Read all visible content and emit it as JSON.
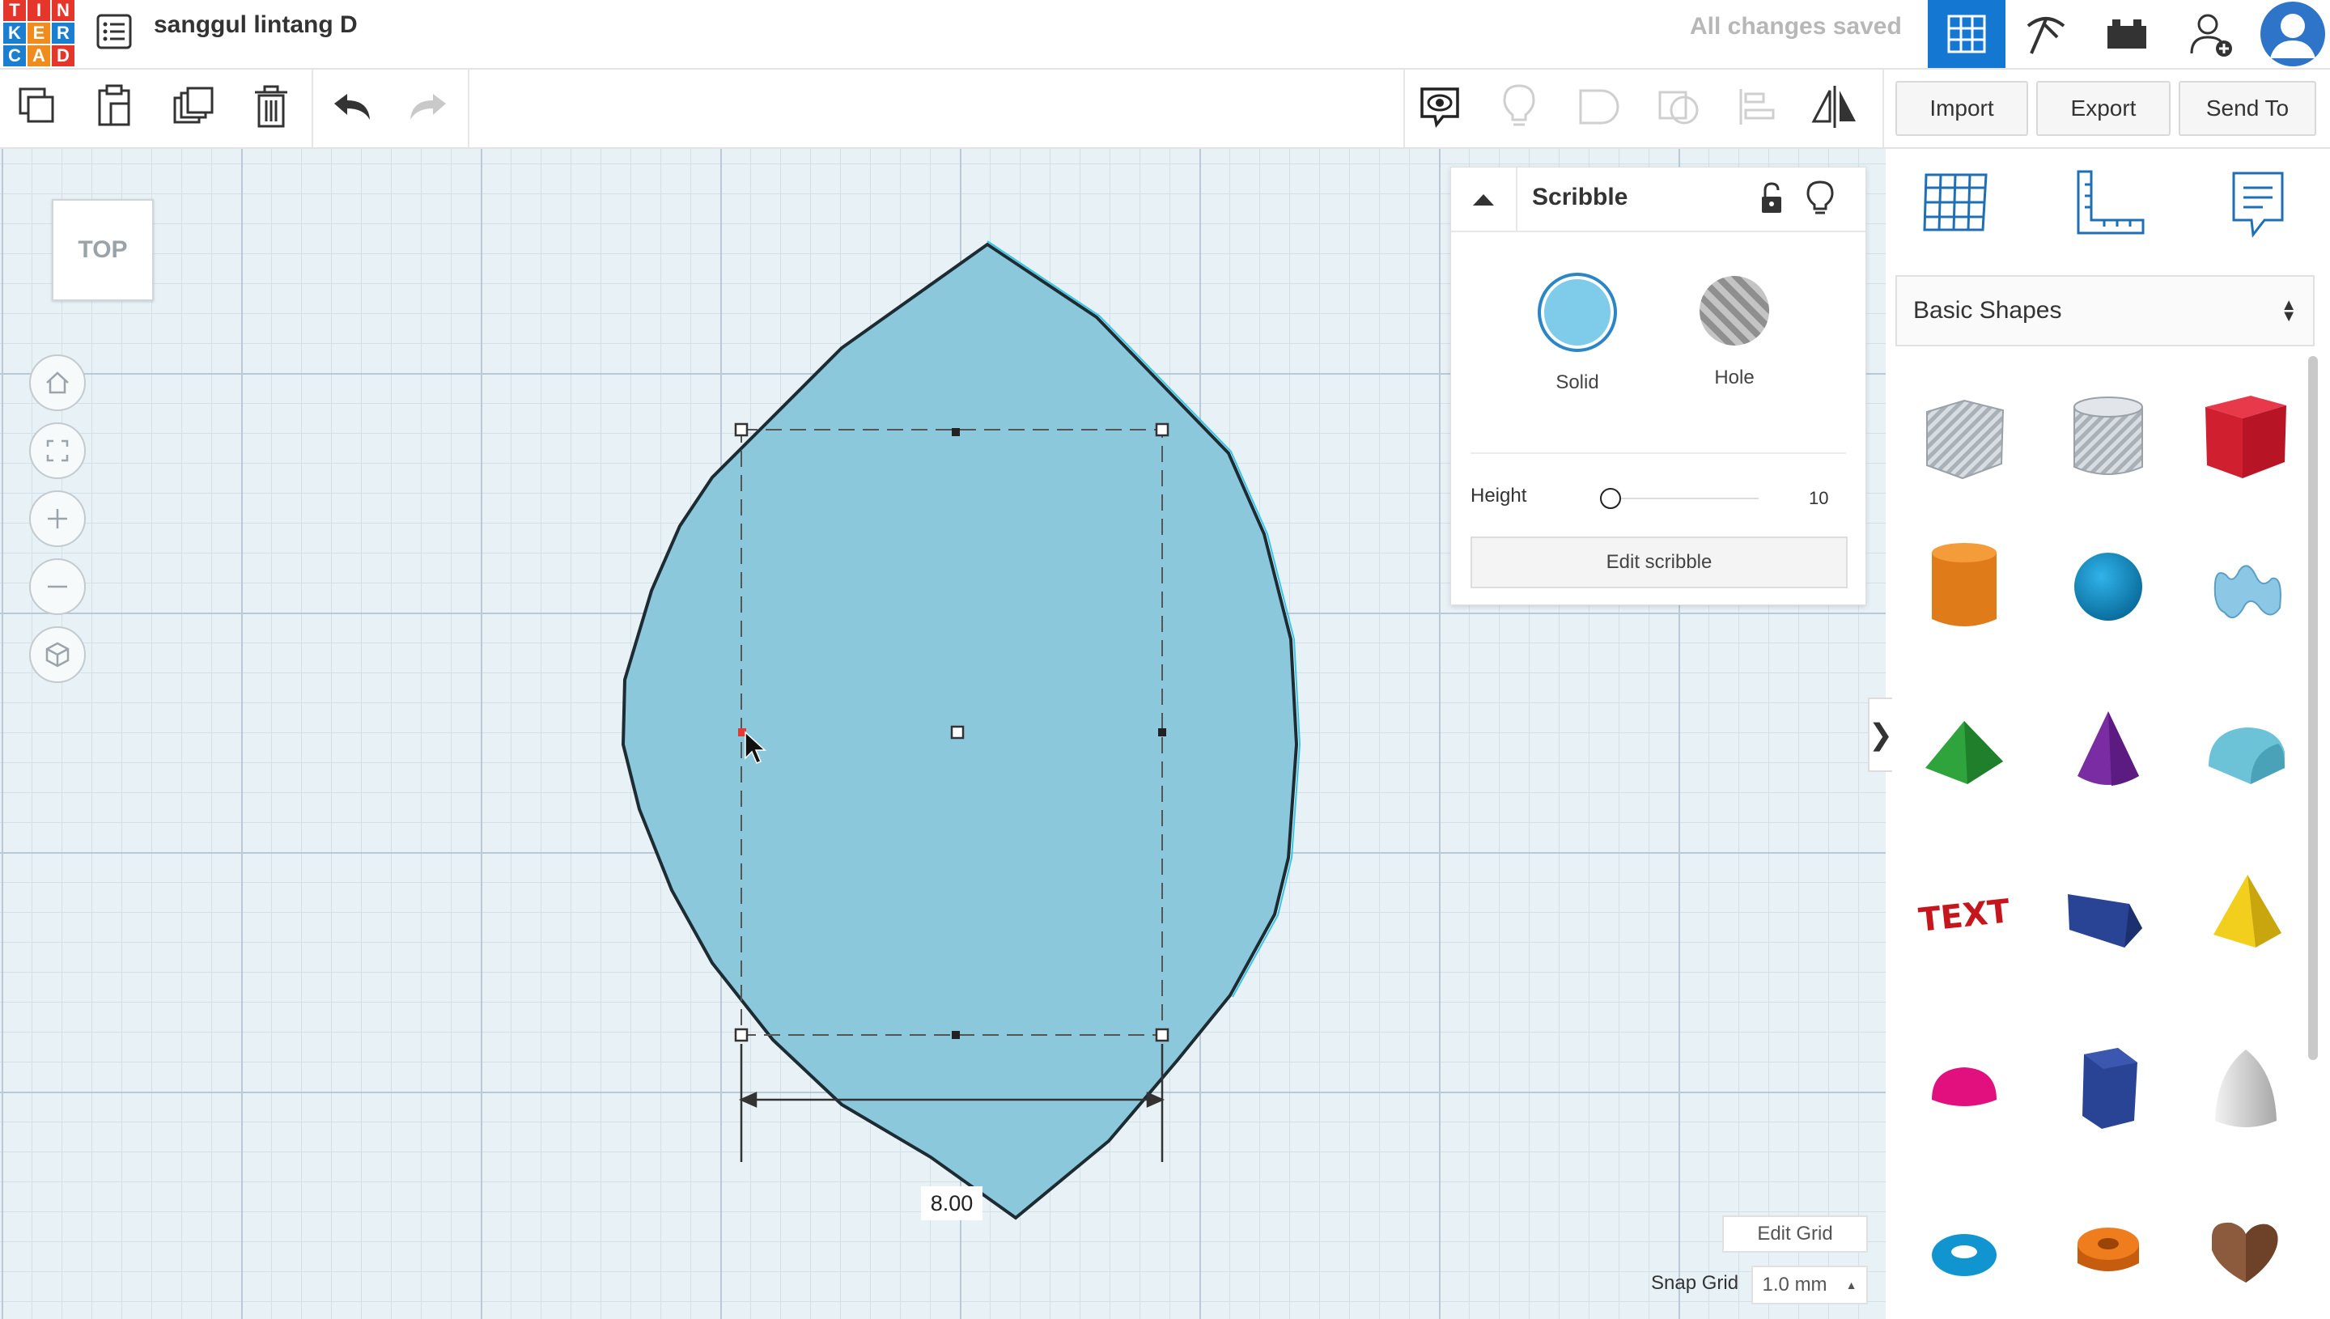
{
  "app": {
    "logo_letters": [
      "T",
      "I",
      "N",
      "K",
      "E",
      "R",
      "C",
      "A",
      "D"
    ],
    "logo_colors": [
      "#e4362a",
      "#e4362a",
      "#e4362a",
      "#1a7fd0",
      "#f08b1d",
      "#1a7fd0",
      "#1a7fd0",
      "#f08b1d",
      "#e4362a"
    ],
    "design_title": "sanggul lintang D",
    "save_status": "All changes saved",
    "accent_color": "#1477d1"
  },
  "top_icons": [
    "design-grid-icon",
    "pickaxe-icon",
    "bricks-icon",
    "add-user-icon",
    "avatar"
  ],
  "toolbar": {
    "left_tools": [
      "copy-icon",
      "paste-icon",
      "duplicate-icon",
      "delete-icon",
      "undo-icon",
      "redo-icon"
    ],
    "right_tools": [
      "notes-eye-icon",
      "lightbulb-icon",
      "group-icon",
      "ungroup-icon",
      "align-icon",
      "mirror-icon"
    ],
    "import_label": "Import",
    "export_label": "Export",
    "send_to_label": "Send To"
  },
  "viewcube": {
    "label": "TOP"
  },
  "nav_buttons": [
    "home-icon",
    "fit-view-icon",
    "zoom-in-icon",
    "zoom-out-icon",
    "perspective-icon"
  ],
  "shape": {
    "fill": "#8cc8dc",
    "outline": "#1d2b33",
    "dimension_value": "8.00"
  },
  "inspector": {
    "name": "Scribble",
    "solid_label": "Solid",
    "hole_label": "Hole",
    "solid_color": "#7fcbea",
    "height_label": "Height",
    "height_value": "10",
    "edit_button_label": "Edit scribble"
  },
  "side_panel": {
    "view_icons": [
      "workplane-icon",
      "ruler-icon",
      "notes-icon"
    ],
    "category_label": "Basic Shapes",
    "shapes": [
      "box-hole",
      "cylinder-hole",
      "box",
      "cylinder",
      "sphere",
      "scribble",
      "roof",
      "cone",
      "round-roof",
      "text",
      "wedge",
      "pyramid",
      "half-sphere",
      "polygon",
      "paraboloid",
      "torus",
      "tube",
      "heart"
    ]
  },
  "grid": {
    "edit_grid_label": "Edit Grid",
    "snap_grid_label": "Snap Grid",
    "snap_grid_value": "1.0 mm"
  }
}
